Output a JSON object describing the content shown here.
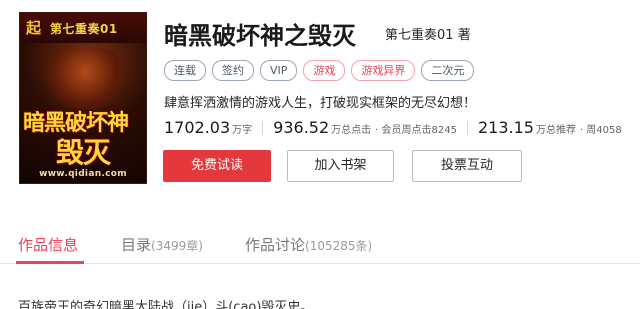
{
  "cover": {
    "logo": "起",
    "series": "第七重奏01",
    "title_line1": "暗黑破坏神",
    "title_line2": "毁灭",
    "url": "www.qidian.com"
  },
  "book": {
    "title": "暗黑破坏神之毁灭",
    "author": "第七重奏01 著",
    "tags": [
      "连载",
      "签约",
      "VIP",
      "游戏",
      "游戏异界",
      "二次元"
    ],
    "intro": "肆意挥洒激情的游戏人生，打破现实框架的无尽幻想！"
  },
  "stats": {
    "words_value": "1702.03",
    "words_unit": "万字",
    "clicks_value": "936.52",
    "clicks_unit": "万总点击",
    "clicks_extra": "· 会员周点击8245",
    "recommend_value": "213.15",
    "recommend_unit": "万总推荐",
    "recommend_extra": "· 周4058"
  },
  "buttons": {
    "read": "免费试读",
    "shelf": "加入书架",
    "vote": "投票互动"
  },
  "tabs": {
    "info": "作品信息",
    "catalog": "目录",
    "catalog_count": "(3499章)",
    "discussion": "作品讨论",
    "discussion_count": "(105285条)"
  },
  "description": "百族帝王的奇幻暗黑大陆战（jie）斗(cao)毁灭史。",
  "colors": {
    "accent": "#ed4259",
    "button_red": "#e4393c"
  }
}
